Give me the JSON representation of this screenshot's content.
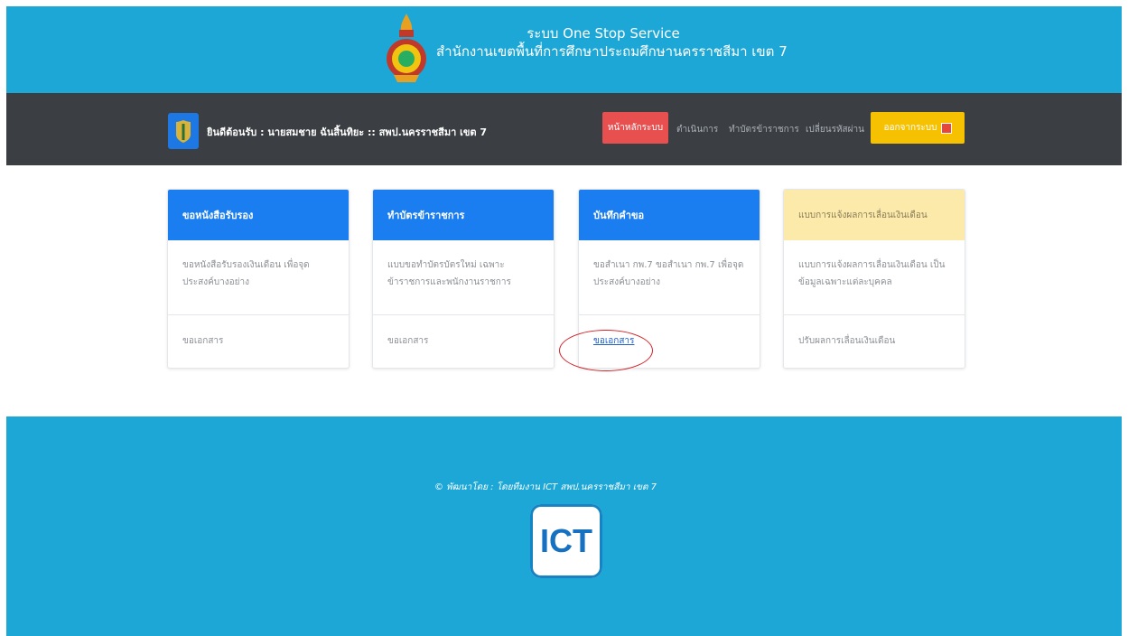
{
  "header": {
    "title": "ระบบ One Stop Service",
    "subtitle": "สำนักงานเขตพื้นที่การศึกษาประถมศึกษานครราชสีมา เขต 7"
  },
  "navbar": {
    "welcome": "ยินดีต้อนรับ : นายสมชาย ฉันสิ้นทิยะ :: สพป.นครราชสีมา เขต 7",
    "home": "หน้าหลักระบบ",
    "link1": "ตำเนินการ",
    "link2": "ทำบัตรข้าราชการ",
    "link3": "เปลี่ยนรหัสผ่าน",
    "logout": "ออกจากระบบ"
  },
  "cards": [
    {
      "header": "ขอหนังสือรับรอง",
      "body": "ขอหนังสือรับรองเงินเดือน เพื่อจุดประสงค์บางอย่าง",
      "footer": "ขอเอกสาร"
    },
    {
      "header": "ทำบัตรข้าราชการ",
      "body": "แบบขอทำบัตรบัตรใหม่ เฉพาะข้าราชการและพนักงานราชการ",
      "footer": "ขอเอกสาร"
    },
    {
      "header": "บันทึกคำขอ",
      "body": "ขอสำเนา กพ.7 ขอสำเนา กพ.7 เพื่อจุดประสงค์บางอย่าง",
      "footer": "ขอเอกสาร"
    },
    {
      "header": "แบบการแจ้งผลการเลื่อนเงินเดือน",
      "body": "แบบการแจ้งผลการเลื่อนเงินเดือน เป็นข้อมูลเฉพาะแต่ละบุคคล",
      "footer": "ปรับผลการเลื่อนเงินเดือน"
    }
  ],
  "footer": {
    "text": "© พัฒนาโดย : โดยทีมงาน ICT สพป.นครราชสีมา เขต 7",
    "logo_text": "ICT"
  },
  "colors": {
    "header_bg": "#1ca7d6",
    "navbar_bg": "#3b3e42",
    "primary": "#1b7ef0",
    "danger": "#e84f4f",
    "warning": "#f5c100",
    "annotation": "#d42027"
  }
}
